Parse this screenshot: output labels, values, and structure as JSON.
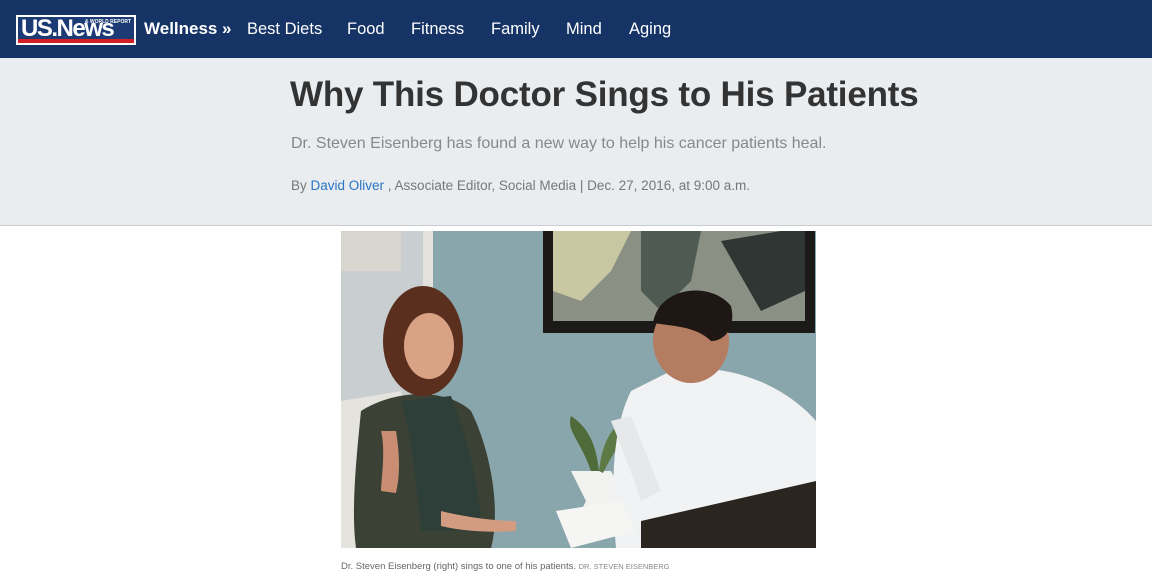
{
  "brand": {
    "logo_text": "US.News",
    "logo_subtext": "& WORLD REPORT",
    "colors": {
      "nav_bg": "#153365",
      "logo_red": "#d31f26",
      "header_bg": "#e9edf0",
      "link": "#2a74c4"
    }
  },
  "nav": {
    "section": "Wellness",
    "chevron": "»",
    "items": [
      "Best Diets",
      "Food",
      "Fitness",
      "Family",
      "Mind",
      "Aging"
    ]
  },
  "article": {
    "headline": "Why This Doctor Sings to His Patients",
    "dek": "Dr. Steven Eisenberg has found a new way to help his cancer patients heal.",
    "byline_prefix": "By ",
    "author": "David Oliver",
    "byline_suffix": " , Associate Editor, Social Media | Dec. 27, 2016, at 9:00 a.m."
  },
  "photo": {
    "caption": "Dr. Steven Eisenberg (right) sings to one of his patients.",
    "credit": "DR. STEVEN EISENBERG"
  }
}
